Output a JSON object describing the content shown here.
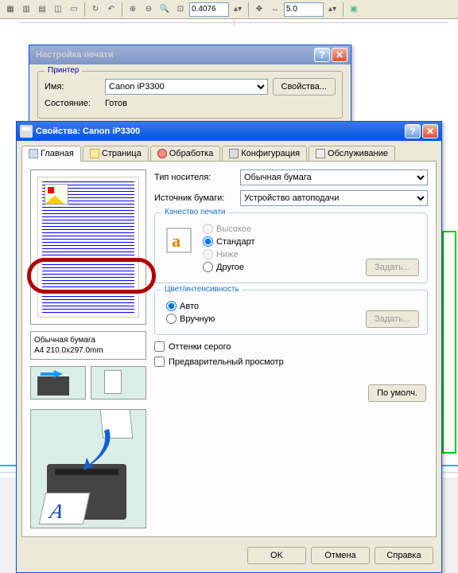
{
  "toolbar": {
    "spin1": "0.4076",
    "spin2": "5.0"
  },
  "printSetup": {
    "title": "Настройка печати",
    "printerLegend": "Принтер",
    "nameLabel": "Имя:",
    "name": "Canon iP3300",
    "propsBtn": "Свойства...",
    "stateLabel": "Состояние:",
    "state": "Готов"
  },
  "props": {
    "title": "Свойства: Canon iP3300",
    "tabs": [
      "Главная",
      "Страница",
      "Обработка",
      "Конфигурация",
      "Обслуживание"
    ],
    "mediaType": {
      "label": "Тип носителя:",
      "value": "Обычная бумага"
    },
    "paperSource": {
      "label": "Источник бумаги:",
      "value": "Устройство автоподачи"
    },
    "quality": {
      "legend": "Качество печати",
      "high": "Высокое",
      "standard": "Стандарт",
      "low": "Ниже",
      "other": "Другое",
      "setBtn": "Задать..."
    },
    "color": {
      "legend": "Цвет/интенсивность",
      "auto": "Авто",
      "manual": "Вручную",
      "setBtn": "Задать..."
    },
    "info": {
      "line1": "Обычная бумага",
      "line2": "A4 210.0x297.0mm"
    },
    "grayscale": "Оттенки серого",
    "preview": "Предварительный просмотр",
    "defaultBtn": "По умолч.",
    "ok": "OK",
    "cancel": "Отмена",
    "help": "Справка"
  }
}
